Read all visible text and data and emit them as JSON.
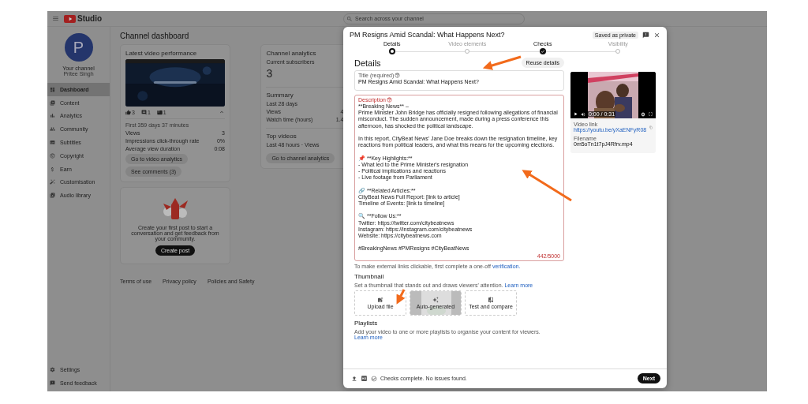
{
  "topbar": {
    "logo": "Studio",
    "search": {
      "placeholder": "Search across your channel"
    }
  },
  "sidebar": {
    "avatar_letter": "P",
    "channel_label": "Your channel",
    "channel_name": "Pritee Singh",
    "items": [
      {
        "label": "Dashboard",
        "selected": true
      },
      {
        "label": "Content",
        "selected": false
      },
      {
        "label": "Analytics",
        "selected": false
      },
      {
        "label": "Community",
        "selected": false
      },
      {
        "label": "Subtitles",
        "selected": false
      },
      {
        "label": "Copyright",
        "selected": false
      },
      {
        "label": "Earn",
        "selected": false
      },
      {
        "label": "Customisation",
        "selected": false
      },
      {
        "label": "Audio library",
        "selected": false
      }
    ],
    "footer_items": [
      {
        "label": "Settings"
      },
      {
        "label": "Send feedback"
      }
    ]
  },
  "dashboard": {
    "title": "Channel dashboard",
    "latest_video": {
      "title": "Latest video performance",
      "stats": [
        "3",
        "1",
        "1"
      ],
      "period": "First 359 days 37 minutes",
      "metrics": [
        {
          "label": "Views",
          "value": "3"
        },
        {
          "label": "Impressions click-through rate",
          "value": "0%"
        },
        {
          "label": "Average view duration",
          "value": "0:08"
        }
      ],
      "buttons": [
        "Go to video analytics",
        "See comments (3)"
      ]
    },
    "create_post": {
      "text": "Create your first post to start a conversation and get feedback from your community.",
      "button": "Create post"
    },
    "channel_analytics": {
      "title": "Channel analytics",
      "subscribers_label": "Current subscribers",
      "subscribers": "3",
      "summary_title": "Summary",
      "summary_period": "Last 28 days",
      "metrics": [
        {
          "label": "Views",
          "value": "4"
        },
        {
          "label": "Watch time (hours)",
          "value": "1.4"
        }
      ],
      "top_title": "Top videos",
      "top_period": "Last 48 hours · Views",
      "button": "Go to channel analytics"
    },
    "footer_links": [
      "Terms of use",
      "Privacy policy",
      "Policies and Safety"
    ]
  },
  "dialog": {
    "title": "PM Resigns Amid Scandal: What Happens Next?",
    "badge": "Saved as private",
    "steps": [
      {
        "label": "Details",
        "selected": true,
        "completed": false
      },
      {
        "label": "Video elements",
        "selected": false,
        "completed": false
      },
      {
        "label": "Checks",
        "selected": false,
        "completed": true
      },
      {
        "label": "Visibility",
        "selected": false,
        "completed": false
      }
    ],
    "heading": "Details",
    "reuse_button": "Reuse details",
    "title_field": {
      "label": "Title (required)",
      "value": "PM Resigns Amid Scandal: What Happens Next?"
    },
    "description_field": {
      "label": "Description",
      "value": "**Breaking News** –\nPrime Minister John Bridge has officially resigned following allegations of financial misconduct. The sudden announcement, made during a press conference this afternoon, has shocked the political landscape.\n\nIn this report, CityBeat News' Jane Doe breaks down the resignation timeline, key reactions from political leaders, and what this means for the upcoming elections.\n\n📌 **Key Highlights:**\n- What led to the Prime Minister's resignation\n- Political implications and reactions\n- Live footage from Parliament\n\n🔗 **Related Articles:**\nCityBeat News Full Report: [link to article]\nTimeline of Events: [link to timeline]\n\n🔍 **Follow Us:**\nTwitter: https://twitter.com/citybeatnews\nInstagram: https://instagram.com/citybeatnews\nWebsite: https://citybeatnews.com\n\n#BreakingNews #PMResigns #CityBeatNews",
      "count": "442/5000"
    },
    "links_note": {
      "text": "To make external links clickable, first complete a one-off",
      "link": "verification."
    },
    "thumbnail": {
      "title": "Thumbnail",
      "text": "Set a thumbnail that stands out and draws viewers' attention.",
      "link": "Learn more",
      "options": [
        {
          "kind": "upload",
          "label": "Upload file"
        },
        {
          "kind": "auto",
          "label": "Auto-generated"
        },
        {
          "kind": "compare",
          "label": "Test and compare"
        }
      ]
    },
    "playlists": {
      "title": "Playlists",
      "text": "Add your video to one or more playlists to organise your content for viewers.",
      "link": "Learn more"
    },
    "preview": {
      "time": "0:00 / 0:31",
      "link_label": "Video link",
      "link": "https://youtu.be/yXaENFyR08",
      "filename_label": "Filename",
      "filename": "0m5oTn1t7pJ4Rfrv.mp4"
    },
    "status": "Checks complete. No issues found.",
    "next_button": "Next"
  }
}
